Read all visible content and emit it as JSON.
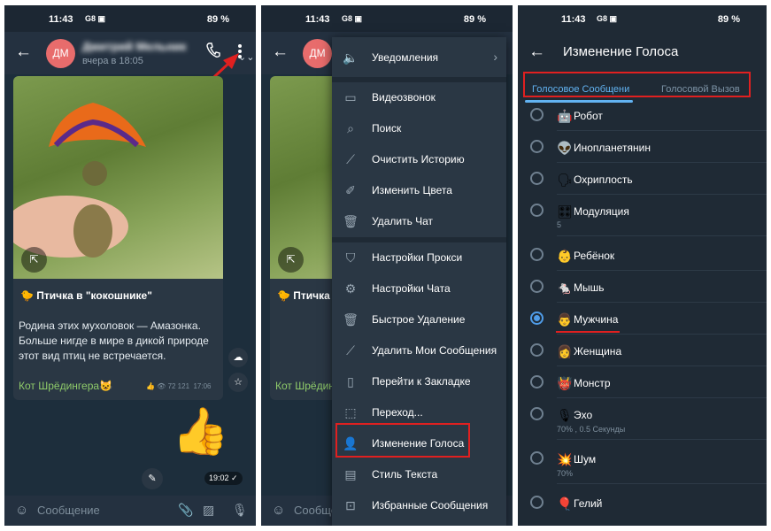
{
  "status": {
    "time": "11:43",
    "battery": "89 %",
    "notif": "G8 ▣"
  },
  "chat": {
    "avatar_initials": "ДМ",
    "contact_name": "Дмитрий Мельник",
    "last_seen": "вчера в 18:05",
    "post_title": "Птичка в \"кокошнике\"",
    "post_body": "Родина этих мухоловок — Амазонка. Больше нигде в мире в дикой природе этот вид птиц не встречается.",
    "post_author": "Кот Шрёдингера",
    "post_views": "72 121",
    "post_time": "17:06",
    "sticker_time": "19:02",
    "composer_placeholder": "Сообщение"
  },
  "menu": {
    "items": [
      {
        "label": "Уведомления",
        "icon": "speaker-icon"
      },
      {
        "label": "Видеозвонок",
        "icon": "video-icon"
      },
      {
        "label": "Поиск",
        "icon": "search-icon"
      },
      {
        "label": "Очистить Историю",
        "icon": "broom-icon"
      },
      {
        "label": "Изменить Цвета",
        "icon": "brush-icon"
      },
      {
        "label": "Удалить Чат",
        "icon": "trash-icon"
      },
      {
        "label": "Настройки Прокси",
        "icon": "shield-icon"
      },
      {
        "label": "Настройки Чата",
        "icon": "gear-icon"
      },
      {
        "label": "Быстрое Удаление",
        "icon": "trash-icon"
      },
      {
        "label": "Удалить Мои Сообщения",
        "icon": "broom-icon"
      },
      {
        "label": "Перейти к Закладке",
        "icon": "bookmark-icon"
      },
      {
        "label": "Переход...",
        "icon": "jump-icon"
      },
      {
        "label": "Изменение Голоса",
        "icon": "voice-user-icon"
      },
      {
        "label": "Стиль Текста",
        "icon": "text-style-icon"
      },
      {
        "label": "Избранные Сообщения",
        "icon": "favorites-icon"
      }
    ]
  },
  "voice": {
    "title": "Изменение Голоса",
    "tabs": [
      "Голосовое Сообщени",
      "Голосовой Вызов"
    ],
    "items": [
      {
        "label": "Робот",
        "emoji": "🤖",
        "sub": ""
      },
      {
        "label": "Инопланетянин",
        "emoji": "👽",
        "sub": ""
      },
      {
        "label": "Охриплость",
        "emoji": "🗣",
        "sub": ""
      },
      {
        "label": "Модуляция",
        "emoji": "🎛",
        "sub": "5"
      },
      {
        "label": "Ребёнок",
        "emoji": "👶",
        "sub": ""
      },
      {
        "label": "Мышь",
        "emoji": "🐁",
        "sub": ""
      },
      {
        "label": "Мужчина",
        "emoji": "👨",
        "sub": "",
        "selected": true
      },
      {
        "label": "Женщина",
        "emoji": "👩",
        "sub": ""
      },
      {
        "label": "Монстр",
        "emoji": "👹",
        "sub": ""
      },
      {
        "label": "Эхо",
        "emoji": "🎙",
        "sub": "70% , 0.5 Секунды"
      },
      {
        "label": "Шум",
        "emoji": "💥",
        "sub": "70%"
      },
      {
        "label": "Гелий",
        "emoji": "🎈",
        "sub": ""
      }
    ]
  },
  "colors": {
    "accent": "#62b3f2",
    "highlight": "#e02020",
    "bg": "#1c2733"
  }
}
